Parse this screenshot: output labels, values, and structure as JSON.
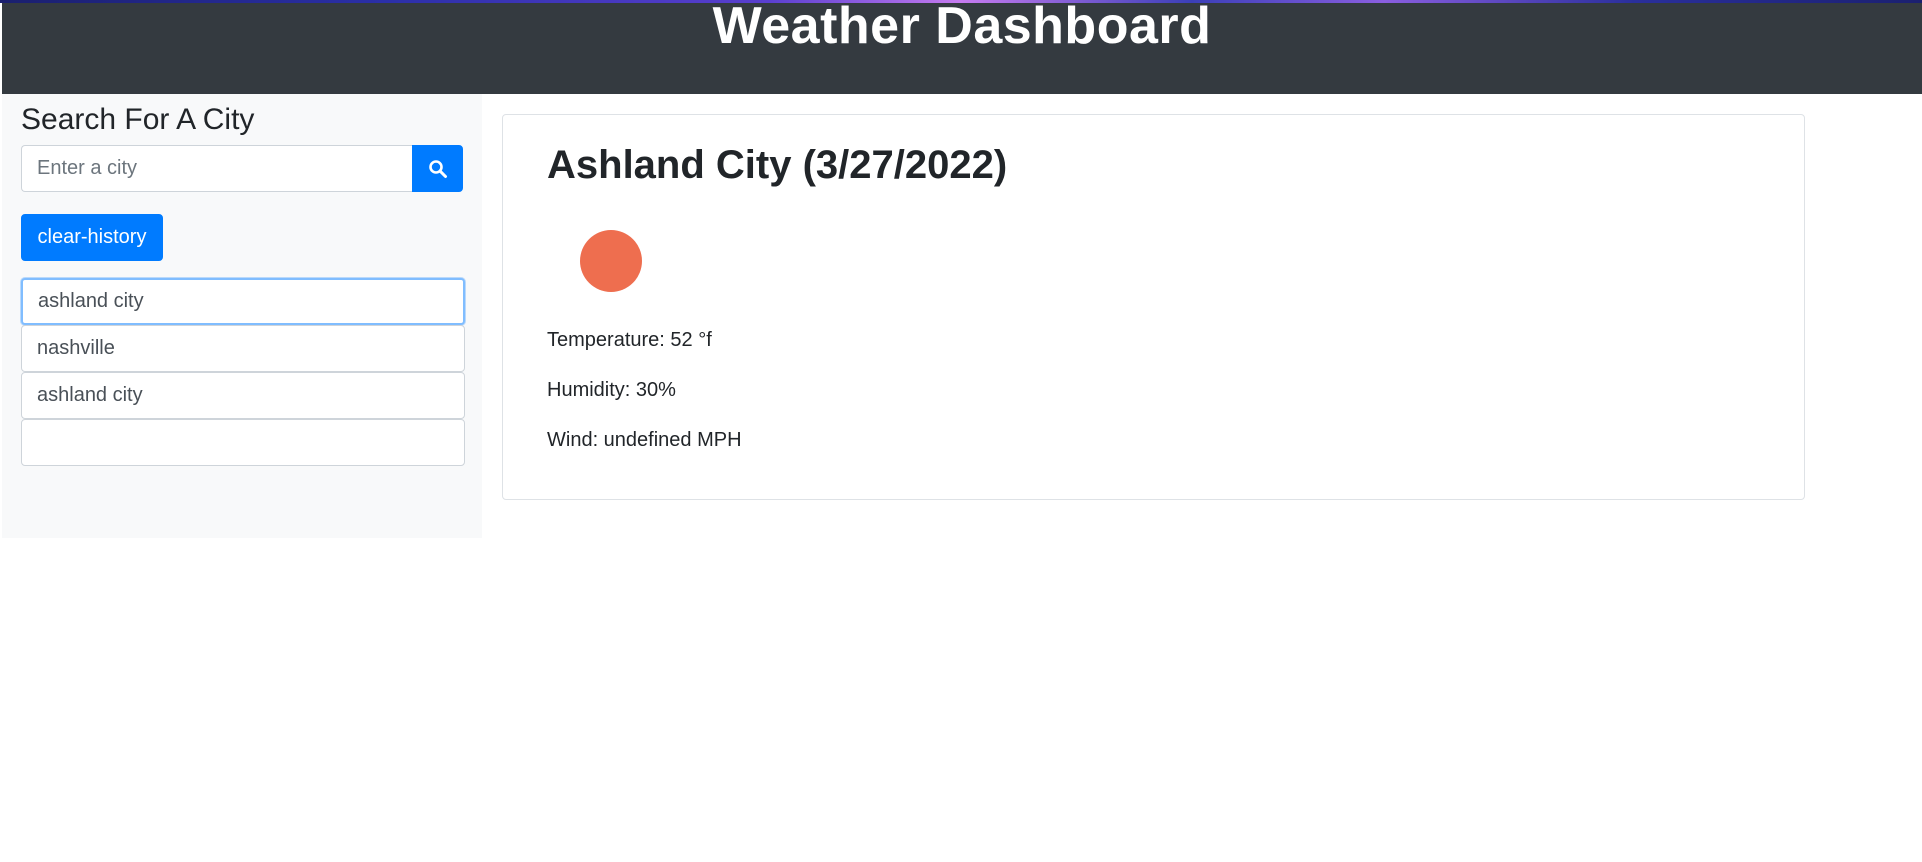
{
  "header": {
    "title": "Weather Dashboard"
  },
  "sidebar": {
    "heading": "Search For A City",
    "search": {
      "placeholder": "Enter a city",
      "value": "",
      "button_icon": "search-icon"
    },
    "clear_label": "clear-history",
    "history": [
      {
        "label": "ashland city",
        "active": true
      },
      {
        "label": "nashville",
        "active": false
      },
      {
        "label": "ashland city",
        "active": false
      },
      {
        "label": "",
        "active": false
      }
    ]
  },
  "current": {
    "title": "Ashland City (3/27/2022)",
    "icon": "weather-icon",
    "temperature": "Temperature: 52 °f",
    "humidity": "Humidity: 30%",
    "wind": "Wind: undefined MPH"
  },
  "colors": {
    "header_bg": "#343a40",
    "primary": "#007bff",
    "sidebar_bg": "#f8f9fa",
    "icon": "#ee6e4f"
  }
}
